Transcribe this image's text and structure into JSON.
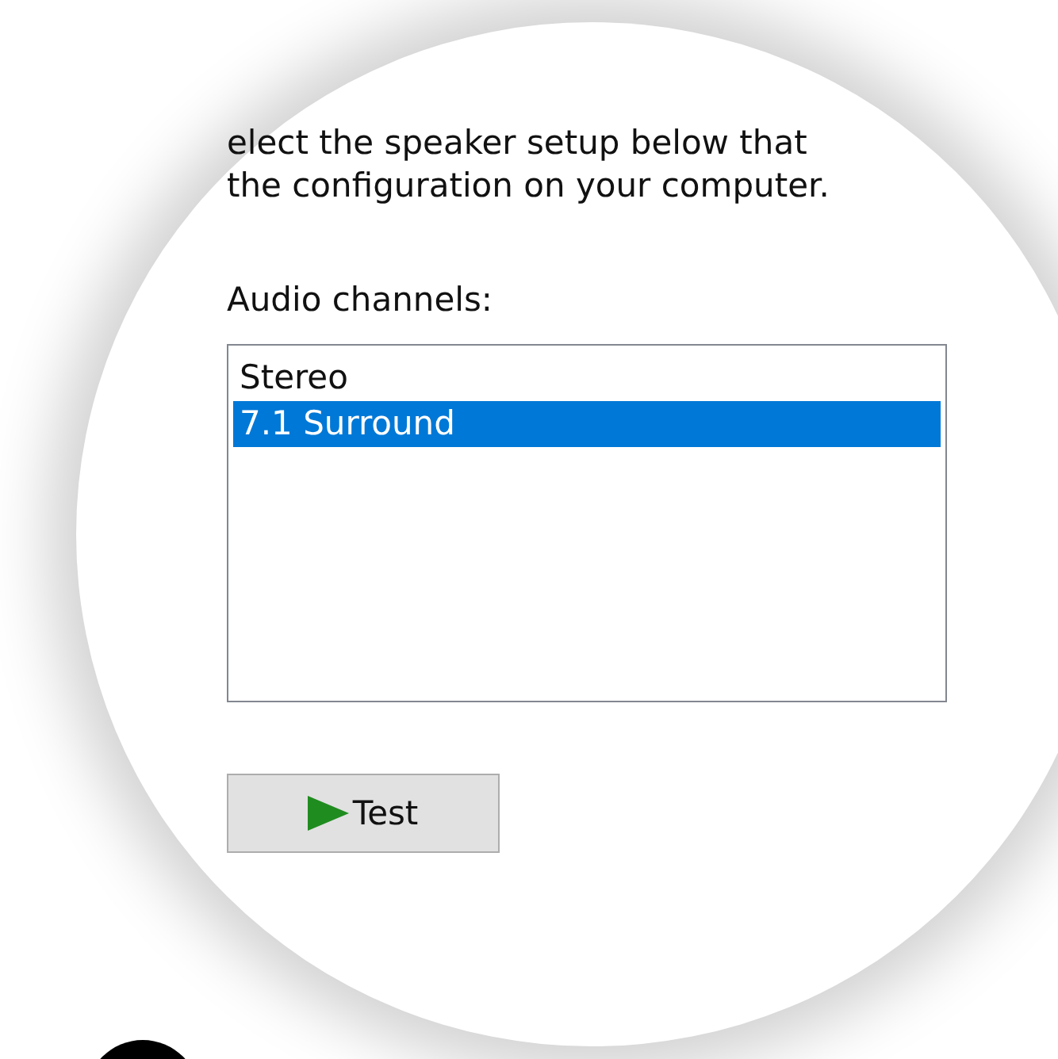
{
  "instructions": [
    "elect the speaker setup below that",
    "the configuration on your computer."
  ],
  "audio_channels": {
    "label": "Audio channels:",
    "items": [
      {
        "label": "Stereo",
        "selected": false
      },
      {
        "label": "7.1 Surround",
        "selected": true
      }
    ]
  },
  "buttons": [
    {
      "label": "Test",
      "kind": "play"
    }
  ]
}
